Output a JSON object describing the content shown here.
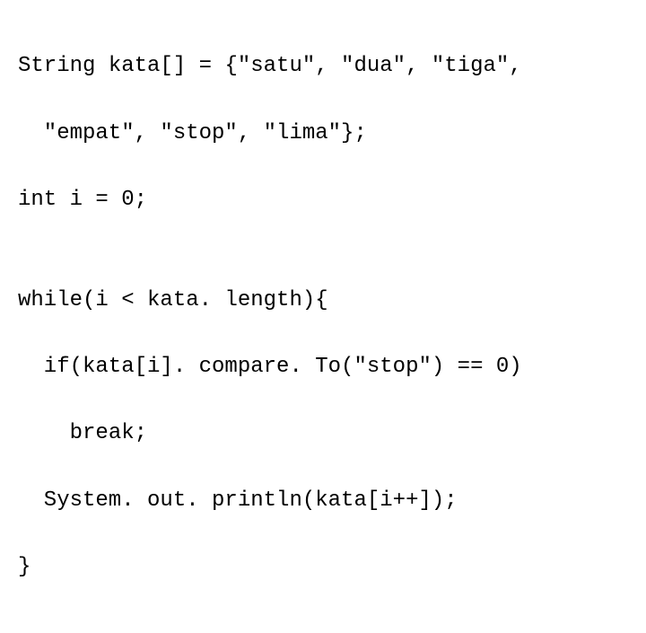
{
  "code": {
    "line1": "String kata[] = {\"satu\", \"dua\", \"tiga\",",
    "line1b": "\"empat\", \"stop\", \"lima\"};",
    "line2": "int i = 0;",
    "blank1": "",
    "line3": "while(i < kata. length){",
    "line4": "if(kata[i]. compare. To(\"stop\") == 0)",
    "line5": "break;",
    "line6": "System. out. println(kata[i++]);",
    "line7": "}"
  }
}
